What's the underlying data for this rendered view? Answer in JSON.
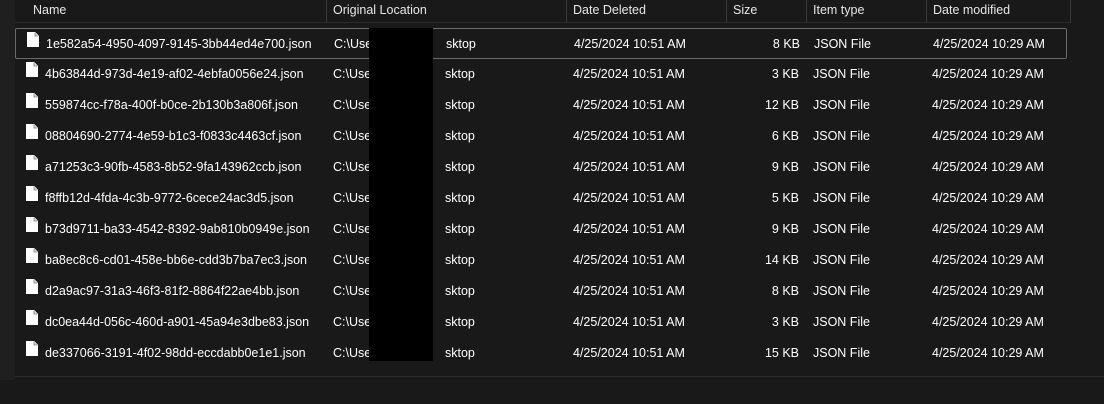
{
  "columns": {
    "name": "Name",
    "original_location": "Original Location",
    "date_deleted": "Date Deleted",
    "size": "Size",
    "item_type": "Item type",
    "date_modified": "Date modified"
  },
  "files": [
    {
      "name": "1e582a54-4950-4097-9145-3bb44ed4e700.json",
      "loc_prefix": "C:\\User",
      "loc_suffix": "sktop",
      "deleted": "4/25/2024 10:51 AM",
      "size": "8 KB",
      "type": "JSON File",
      "modified": "4/25/2024 10:29 AM",
      "selected": true
    },
    {
      "name": "4b63844d-973d-4e19-af02-4ebfa0056e24.json",
      "loc_prefix": "C:\\User",
      "loc_suffix": "sktop",
      "deleted": "4/25/2024 10:51 AM",
      "size": "3 KB",
      "type": "JSON File",
      "modified": "4/25/2024 10:29 AM",
      "selected": false
    },
    {
      "name": "559874cc-f78a-400f-b0ce-2b130b3a806f.json",
      "loc_prefix": "C:\\User",
      "loc_suffix": "sktop",
      "deleted": "4/25/2024 10:51 AM",
      "size": "12 KB",
      "type": "JSON File",
      "modified": "4/25/2024 10:29 AM",
      "selected": false
    },
    {
      "name": "08804690-2774-4e59-b1c3-f0833c4463cf.json",
      "loc_prefix": "C:\\User",
      "loc_suffix": "sktop",
      "deleted": "4/25/2024 10:51 AM",
      "size": "6 KB",
      "type": "JSON File",
      "modified": "4/25/2024 10:29 AM",
      "selected": false
    },
    {
      "name": "a71253c3-90fb-4583-8b52-9fa143962ccb.json",
      "loc_prefix": "C:\\User",
      "loc_suffix": "sktop",
      "deleted": "4/25/2024 10:51 AM",
      "size": "9 KB",
      "type": "JSON File",
      "modified": "4/25/2024 10:29 AM",
      "selected": false
    },
    {
      "name": "f8ffb12d-4fda-4c3b-9772-6cece24ac3d5.json",
      "loc_prefix": "C:\\Use",
      "loc_suffix": "sktop",
      "deleted": "4/25/2024 10:51 AM",
      "size": "5 KB",
      "type": "JSON File",
      "modified": "4/25/2024 10:29 AM",
      "selected": false
    },
    {
      "name": "b73d9711-ba33-4542-8392-9ab810b0949e.json",
      "loc_prefix": "C:\\Use",
      "loc_suffix": "sktop",
      "deleted": "4/25/2024 10:51 AM",
      "size": "9 KB",
      "type": "JSON File",
      "modified": "4/25/2024 10:29 AM",
      "selected": false
    },
    {
      "name": "ba8ec8c6-cd01-458e-bb6e-cdd3b7ba7ec3.json",
      "loc_prefix": "C:\\Use",
      "loc_suffix": "sktop",
      "deleted": "4/25/2024 10:51 AM",
      "size": "14 KB",
      "type": "JSON File",
      "modified": "4/25/2024 10:29 AM",
      "selected": false
    },
    {
      "name": "d2a9ac97-31a3-46f3-81f2-8864f22ae4bb.json",
      "loc_prefix": "C:\\Use",
      "loc_suffix": "sktop",
      "deleted": "4/25/2024 10:51 AM",
      "size": "8 KB",
      "type": "JSON File",
      "modified": "4/25/2024 10:29 AM",
      "selected": false
    },
    {
      "name": "dc0ea44d-056c-460d-a901-45a94e3dbe83.json",
      "loc_prefix": "C:\\Use",
      "loc_suffix": "sktop",
      "deleted": "4/25/2024 10:51 AM",
      "size": "3 KB",
      "type": "JSON File",
      "modified": "4/25/2024 10:29 AM",
      "selected": false
    },
    {
      "name": "de337066-3191-4f02-98dd-eccdabb0e1e1.json",
      "loc_prefix": "C:\\Use",
      "loc_suffix": "sktop",
      "deleted": "4/25/2024 10:51 AM",
      "size": "15 KB",
      "type": "JSON File",
      "modified": "4/25/2024 10:29 AM",
      "selected": false
    }
  ],
  "colors": {
    "background": "#191919",
    "text": "#ffffff",
    "header_text": "#e6e6e6",
    "separator": "#3a3a3a",
    "selection_border": "#6b6b6b",
    "redaction": "#000000"
  },
  "icons": {
    "file": "file-icon"
  }
}
